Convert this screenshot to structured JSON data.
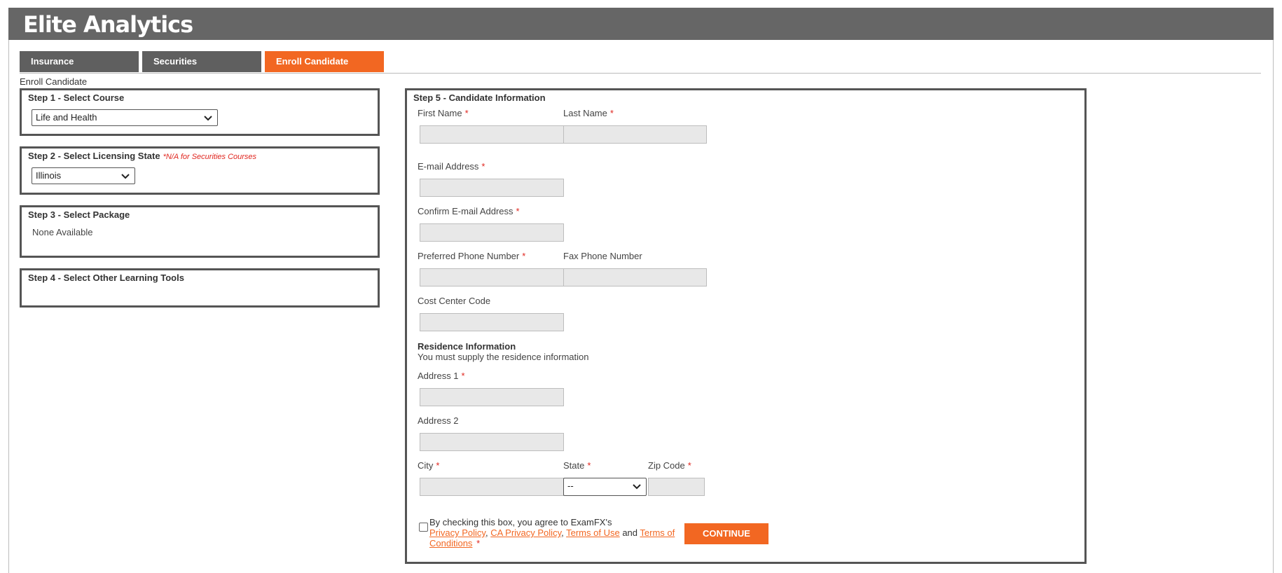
{
  "app": {
    "title": "Elite Analytics"
  },
  "tabs": [
    {
      "label": "Insurance"
    },
    {
      "label": "Securities"
    },
    {
      "label": "Enroll Candidate"
    }
  ],
  "page": {
    "heading": "Enroll Candidate"
  },
  "step1": {
    "title": "Step 1 - Select Course",
    "selected": "Life and Health"
  },
  "step2": {
    "title": "Step 2 - Select Licensing State",
    "note": "*N/A for Securities Courses",
    "selected": "Illinois"
  },
  "step3": {
    "title": "Step 3 - Select Package",
    "text": "None Available"
  },
  "step4": {
    "title": "Step 4 - Select Other Learning Tools"
  },
  "step5": {
    "title": "Step 5 - Candidate Information",
    "first_name": {
      "label": "First Name",
      "value": ""
    },
    "last_name": {
      "label": "Last Name",
      "value": ""
    },
    "email": {
      "label": "E-mail Address",
      "value": ""
    },
    "confirm_email": {
      "label": "Confirm E-mail Address",
      "value": ""
    },
    "phone": {
      "label": "Preferred Phone Number",
      "value": ""
    },
    "fax": {
      "label": "Fax Phone Number",
      "value": ""
    },
    "cost_center": {
      "label": "Cost Center Code",
      "value": ""
    },
    "residence": {
      "heading": "Residence Information",
      "subtext": "You must supply the residence information",
      "address1": {
        "label": "Address 1",
        "value": ""
      },
      "address2": {
        "label": "Address 2",
        "value": ""
      },
      "city": {
        "label": "City",
        "value": ""
      },
      "state": {
        "label": "State",
        "selected": "--"
      },
      "zip": {
        "label": "Zip Code",
        "value": ""
      }
    },
    "required_mark": "*",
    "consent": {
      "prefix": "By checking this box, you agree to ExamFX's",
      "privacy_policy": "Privacy Policy",
      "sep1": ",",
      "ca_privacy_policy": "CA Privacy Policy",
      "sep2": ",",
      "terms_of_use": "Terms of Use",
      "and": "and",
      "terms_of_conditions": "Terms of Conditions",
      "checked": false
    },
    "continue_label": "CONTINUE"
  },
  "colors": {
    "accent": "#f26722",
    "header_bg": "#666666",
    "tab_gray": "#5f5f5f",
    "required": "#e0261f",
    "input_bg": "#e8e8e8"
  },
  "icons": {
    "dropdown": "chevron-down-icon"
  }
}
